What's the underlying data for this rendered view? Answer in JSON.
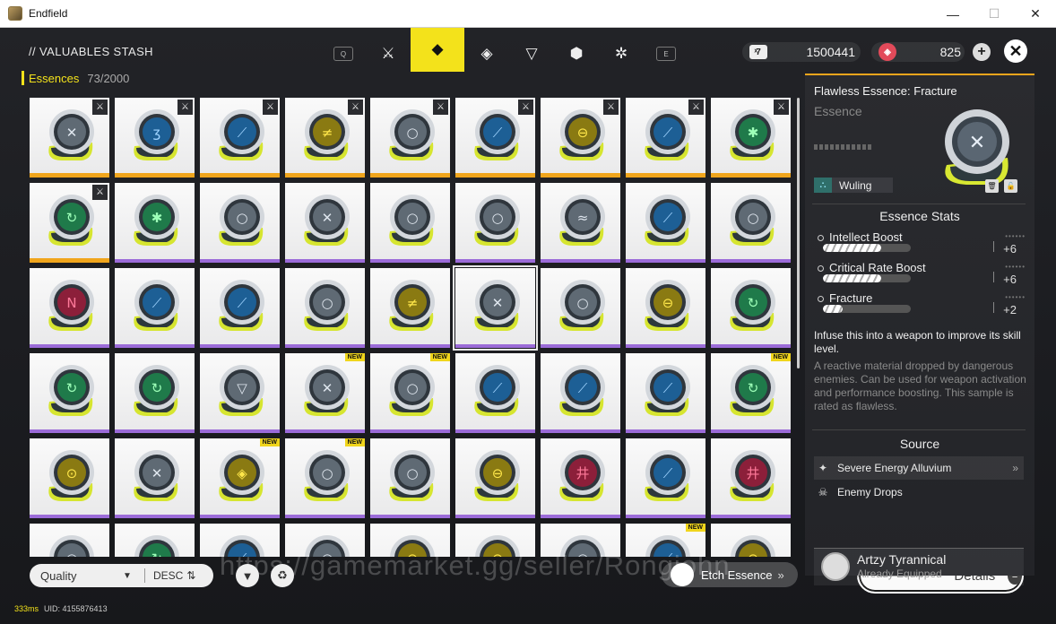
{
  "window": {
    "title": "Endfield",
    "min": "—",
    "max": "☐",
    "close": "✕"
  },
  "header": {
    "stash_title": "// VALUABLES STASH",
    "tabs": [
      {
        "name": "q-key-hint",
        "glyph": "Q"
      },
      {
        "name": "weapon-tab",
        "glyph": "⚔"
      },
      {
        "name": "essence-tab",
        "glyph": "◆",
        "active": true
      },
      {
        "name": "gear-tab",
        "glyph": "◈"
      },
      {
        "name": "material-tab",
        "glyph": "▽"
      },
      {
        "name": "supply-tab",
        "glyph": "⬢"
      },
      {
        "name": "misc-tab",
        "glyph": "✲"
      },
      {
        "name": "e-key-hint",
        "glyph": "E"
      }
    ],
    "currency1": {
      "value": "1500441",
      "icon": "ticket-icon"
    },
    "currency2": {
      "value": "825",
      "icon": "crystal-icon"
    }
  },
  "category": {
    "label": "Essences",
    "count": "73/2000"
  },
  "colors": {
    "accent": "#f3e21b",
    "gold": "#f0a51c",
    "purple": "#9b6bd8"
  },
  "grid": [
    [
      {
        "c": "grey",
        "s": "✕",
        "r": "gold",
        "eq": true
      },
      {
        "c": "blue",
        "s": "ʒ",
        "r": "gold",
        "eq": true
      },
      {
        "c": "blue",
        "s": "⟋",
        "r": "gold",
        "eq": true
      },
      {
        "c": "yellow",
        "s": "≠",
        "r": "gold",
        "eq": true
      },
      {
        "c": "grey",
        "s": "○",
        "r": "gold",
        "eq": true
      },
      {
        "c": "blue",
        "s": "⟋",
        "r": "gold",
        "eq": true
      },
      {
        "c": "yellow",
        "s": "⊖",
        "r": "gold",
        "eq": true
      },
      {
        "c": "blue",
        "s": "⟋",
        "r": "gold",
        "eq": true
      },
      {
        "c": "green",
        "s": "✱",
        "r": "gold",
        "eq": true
      }
    ],
    [
      {
        "c": "green",
        "s": "↻",
        "r": "gold",
        "eq": true
      },
      {
        "c": "green",
        "s": "✱",
        "r": "purp"
      },
      {
        "c": "grey",
        "s": "○",
        "r": "purp"
      },
      {
        "c": "grey",
        "s": "✕",
        "r": "purp"
      },
      {
        "c": "grey",
        "s": "○",
        "r": "purp"
      },
      {
        "c": "grey",
        "s": "○",
        "r": "purp"
      },
      {
        "c": "grey",
        "s": "≈",
        "r": "purp"
      },
      {
        "c": "blue",
        "s": "⟋",
        "r": "purp"
      },
      {
        "c": "grey",
        "s": "○",
        "r": "purp"
      }
    ],
    [
      {
        "c": "red",
        "s": "N",
        "r": "purp"
      },
      {
        "c": "blue",
        "s": "⟋",
        "r": "purp"
      },
      {
        "c": "blue",
        "s": "⟋",
        "r": "purp"
      },
      {
        "c": "grey",
        "s": "○",
        "r": "purp"
      },
      {
        "c": "yellow",
        "s": "≠",
        "r": "purp"
      },
      {
        "c": "grey",
        "s": "✕",
        "r": "purp",
        "sel": true
      },
      {
        "c": "grey",
        "s": "○",
        "r": "purp"
      },
      {
        "c": "yellow",
        "s": "⊖",
        "r": "purp"
      },
      {
        "c": "green",
        "s": "↻",
        "r": "purp"
      }
    ],
    [
      {
        "c": "green",
        "s": "↻",
        "r": "purp"
      },
      {
        "c": "green",
        "s": "↻",
        "r": "purp"
      },
      {
        "c": "grey",
        "s": "▽",
        "r": "purp"
      },
      {
        "c": "grey",
        "s": "✕",
        "r": "purp",
        "nw": true
      },
      {
        "c": "grey",
        "s": "○",
        "r": "purp",
        "nw": true
      },
      {
        "c": "blue",
        "s": "⟋",
        "r": "purp"
      },
      {
        "c": "blue",
        "s": "⟋",
        "r": "purp"
      },
      {
        "c": "blue",
        "s": "⟋",
        "r": "purp"
      },
      {
        "c": "green",
        "s": "↻",
        "r": "purp",
        "nw": true
      }
    ],
    [
      {
        "c": "yellow",
        "s": "⊙",
        "r": "purp"
      },
      {
        "c": "grey",
        "s": "✕",
        "r": "purp"
      },
      {
        "c": "yellow",
        "s": "◈",
        "r": "purp",
        "nw": true
      },
      {
        "c": "grey",
        "s": "○",
        "r": "purp",
        "nw": true
      },
      {
        "c": "grey",
        "s": "○",
        "r": "purp"
      },
      {
        "c": "yellow",
        "s": "⊖",
        "r": "purp"
      },
      {
        "c": "red",
        "s": "井",
        "r": "purp"
      },
      {
        "c": "blue",
        "s": "⟋",
        "r": "purp"
      },
      {
        "c": "red",
        "s": "井",
        "r": "purp"
      }
    ],
    [
      {
        "c": "grey",
        "s": "○",
        "r": "purp"
      },
      {
        "c": "green",
        "s": "↻",
        "r": "purp"
      },
      {
        "c": "blue",
        "s": "⟋",
        "r": "purp"
      },
      {
        "c": "grey",
        "s": "○",
        "r": "purp"
      },
      {
        "c": "yellow",
        "s": "⊖",
        "r": "purp"
      },
      {
        "c": "yellow",
        "s": "⊖",
        "r": "purp"
      },
      {
        "c": "grey",
        "s": "○",
        "r": "purp"
      },
      {
        "c": "blue",
        "s": "⟋",
        "r": "purp",
        "nw": true
      },
      {
        "c": "yellow",
        "s": "⊖",
        "r": "purp"
      }
    ]
  ],
  "tile_labels": {
    "new": "NEW",
    "equipped_icon": "sword-icon"
  },
  "toolbar": {
    "sort_label": "Quality",
    "order_label": "DESC",
    "etch_label": "Etch Essence",
    "details_label": "Details",
    "watermark": "https://gamemarket.gg/seller/Rongjohn"
  },
  "status": {
    "latency": "333ms",
    "uid": "UID: 4155876413"
  },
  "detail": {
    "name": "Flawless Essence: Fracture",
    "type": "Essence",
    "tag": "Wuling",
    "stats_title": "Essence Stats",
    "stats": [
      {
        "name": "Intellect Boost",
        "level": 6,
        "max": 9,
        "value": "+6"
      },
      {
        "name": "Critical Rate Boost",
        "level": 6,
        "max": 9,
        "value": "+6"
      },
      {
        "name": "Fracture",
        "level": 2,
        "max": 9,
        "value": "+2"
      }
    ],
    "desc_main": "Infuse this into a weapon to improve its skill level.",
    "desc_flavor": "A reactive material dropped by dangerous enemies. Can be used for weapon activation and performance boosting. This sample is rated as flawless.",
    "source_title": "Source",
    "sources": [
      {
        "label": "Severe Energy Alluvium",
        "icon": "energy-icon"
      },
      {
        "label": "Enemy Drops",
        "icon": "enemy-icon"
      }
    ],
    "equipped_by": {
      "name": "Artzy Tyrannical",
      "status": "Already Equipped"
    }
  }
}
